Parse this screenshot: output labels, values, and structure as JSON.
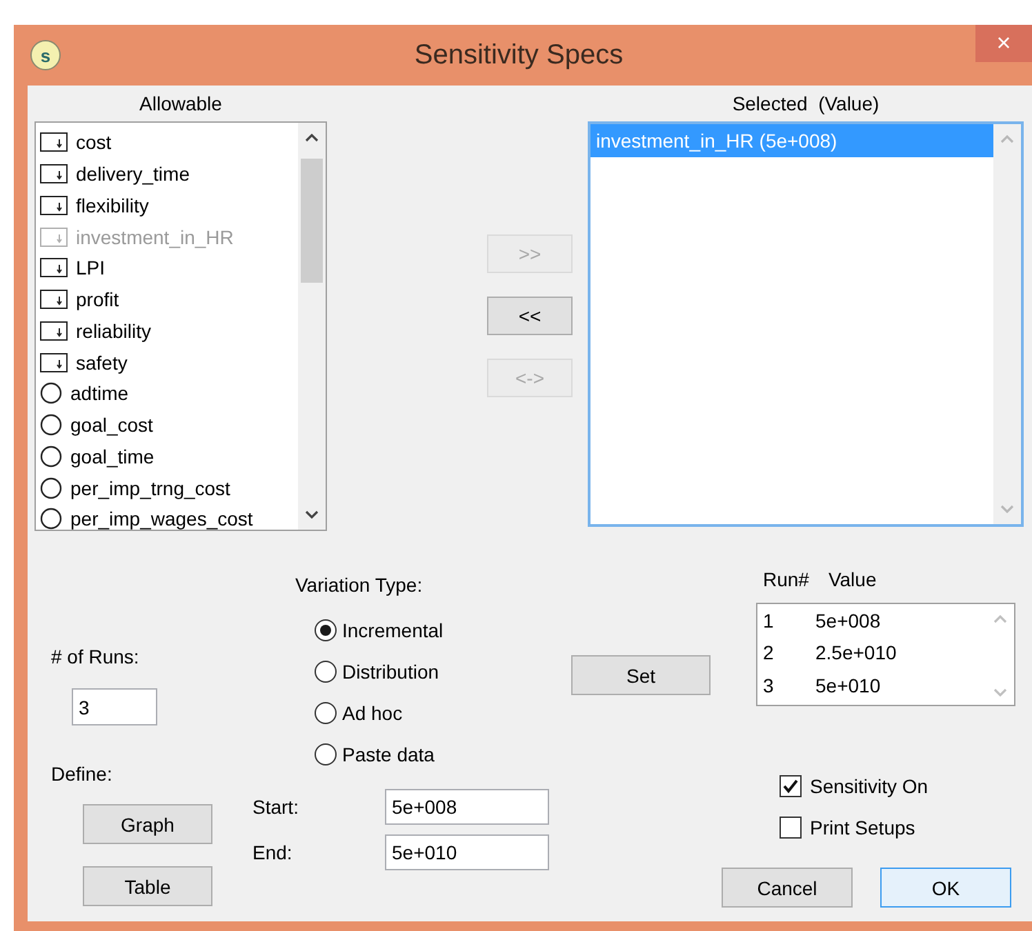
{
  "window": {
    "title": "Sensitivity Specs",
    "icon_letter": "s",
    "close": "×"
  },
  "allowable": {
    "label": "Allowable",
    "items": [
      {
        "name": "cost",
        "kind": "stock",
        "disabled": false
      },
      {
        "name": "delivery_time",
        "kind": "stock",
        "disabled": false
      },
      {
        "name": "flexibility",
        "kind": "stock",
        "disabled": false
      },
      {
        "name": "investment_in_HR",
        "kind": "stock",
        "disabled": true
      },
      {
        "name": "LPI",
        "kind": "stock",
        "disabled": false
      },
      {
        "name": "profit",
        "kind": "stock",
        "disabled": false
      },
      {
        "name": "reliability",
        "kind": "stock",
        "disabled": false
      },
      {
        "name": "safety",
        "kind": "stock",
        "disabled": false
      },
      {
        "name": "adtime",
        "kind": "converter",
        "disabled": false
      },
      {
        "name": "goal_cost",
        "kind": "converter",
        "disabled": false
      },
      {
        "name": "goal_time",
        "kind": "converter",
        "disabled": false
      },
      {
        "name": "per_imp_trng_cost",
        "kind": "converter",
        "disabled": false
      },
      {
        "name": "per_imp_wages_cost",
        "kind": "converter",
        "disabled": false
      }
    ]
  },
  "transfer_buttons": [
    {
      "label": ">>",
      "disabled": true
    },
    {
      "label": "<<",
      "disabled": false
    },
    {
      "label": "<->",
      "disabled": true
    }
  ],
  "selected_list": {
    "label": "Selected  (Value)",
    "items": [
      {
        "text": "investment_in_HR (5e+008)",
        "selected": true
      }
    ]
  },
  "variation_type": {
    "label": "Variation Type:",
    "options": [
      {
        "label": "Incremental",
        "selected": true
      },
      {
        "label": "Distribution",
        "selected": false
      },
      {
        "label": "Ad hoc",
        "selected": false
      },
      {
        "label": "Paste data",
        "selected": false
      }
    ]
  },
  "runs": {
    "label": "# of Runs:",
    "value": "3"
  },
  "define": {
    "label": "Define:",
    "buttons": [
      "Graph",
      "Table"
    ]
  },
  "start": {
    "label": "Start:",
    "value": "5e+008"
  },
  "end": {
    "label": "End:",
    "value": "5e+010"
  },
  "set_button": "Set",
  "run_table": {
    "columns": [
      "Run#",
      "Value"
    ],
    "rows": [
      [
        "1",
        "5e+008"
      ],
      [
        "2",
        "2.5e+010"
      ],
      [
        "3",
        "5e+010"
      ]
    ]
  },
  "options": [
    {
      "label": "Sensitivity On",
      "checked": true
    },
    {
      "label": "Print Setups",
      "checked": false
    }
  ],
  "buttons": [
    {
      "label": "Cancel",
      "default": false
    },
    {
      "label": "OK",
      "default": true
    }
  ]
}
